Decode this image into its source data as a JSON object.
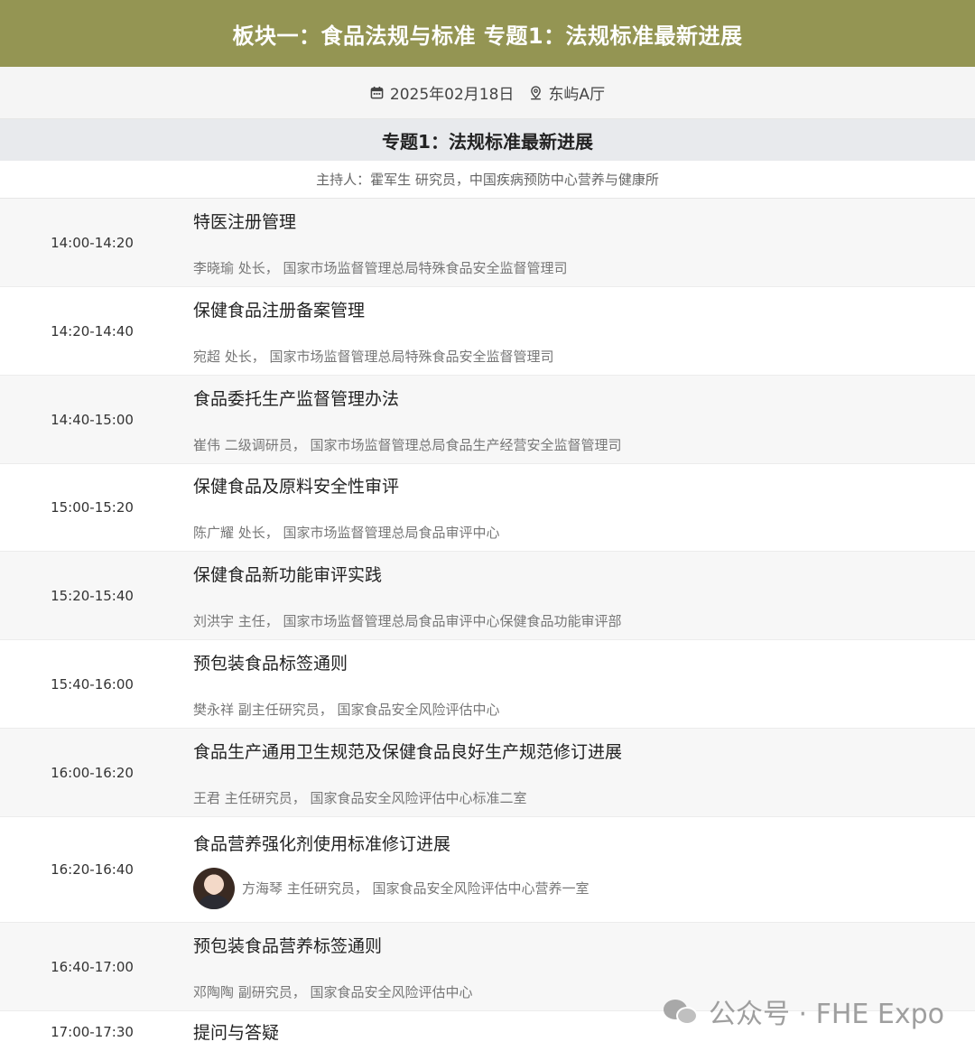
{
  "banner": {
    "title": "板块一：食品法规与标准 专题1：法规标准最新进展"
  },
  "meta": {
    "date": "2025年02月18日",
    "location": "东屿A厅",
    "date_icon": "calendar-icon",
    "location_icon": "map-pin-icon"
  },
  "topic": {
    "title": "专题1：法规标准最新进展"
  },
  "host": {
    "text": "主持人：霍军生 研究员，中国疾病预防中心营养与健康所"
  },
  "sessions": [
    {
      "time": "14:00-14:20",
      "title": "特医注册管理",
      "speaker": "李晓瑜 处长， 国家市场监督管理总局特殊食品安全监督管理司"
    },
    {
      "time": "14:20-14:40",
      "title": "保健食品注册备案管理",
      "speaker": "宛超 处长， 国家市场监督管理总局特殊食品安全监督管理司"
    },
    {
      "time": "14:40-15:00",
      "title": "食品委托生产监督管理办法",
      "speaker": "崔伟 二级调研员， 国家市场监督管理总局食品生产经营安全监督管理司"
    },
    {
      "time": "15:00-15:20",
      "title": "保健食品及原料安全性审评",
      "speaker": "陈广耀 处长， 国家市场监督管理总局食品审评中心"
    },
    {
      "time": "15:20-15:40",
      "title": "保健食品新功能审评实践",
      "speaker": "刘洪宇 主任， 国家市场监督管理总局食品审评中心保健食品功能审评部"
    },
    {
      "time": "15:40-16:00",
      "title": "预包装食品标签通则",
      "speaker": "樊永祥 副主任研究员， 国家食品安全风险评估中心"
    },
    {
      "time": "16:00-16:20",
      "title": "食品生产通用卫生规范及保健食品良好生产规范修订进展",
      "speaker": "王君 主任研究员， 国家食品安全风险评估中心标准二室"
    },
    {
      "time": "16:20-16:40",
      "title": "食品营养强化剂使用标准修订进展",
      "speaker": "方海琴 主任研究员， 国家食品安全风险评估中心营养一室"
    },
    {
      "time": "16:40-17:00",
      "title": "预包装食品营养标签通则",
      "speaker": "邓陶陶 副研究员， 国家食品安全风险评估中心"
    },
    {
      "time": "17:00-17:30",
      "title": "提问与答疑",
      "speaker": ""
    }
  ],
  "watermark": {
    "text": "公众号 · FHE Expo",
    "icon": "wechat-icon"
  }
}
